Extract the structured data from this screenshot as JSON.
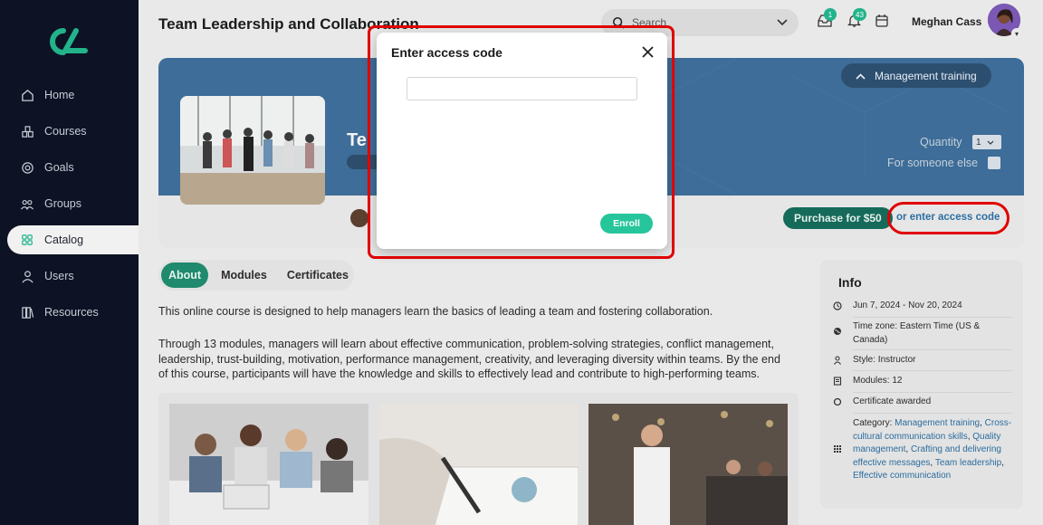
{
  "app": {
    "page_title": "Team Leadership and Collaboration"
  },
  "sidebar": {
    "items": [
      {
        "label": "Home",
        "icon": "home-icon"
      },
      {
        "label": "Courses",
        "icon": "courses-icon"
      },
      {
        "label": "Goals",
        "icon": "goals-icon"
      },
      {
        "label": "Groups",
        "icon": "groups-icon"
      },
      {
        "label": "Catalog",
        "icon": "catalog-icon",
        "active": true
      },
      {
        "label": "Users",
        "icon": "users-icon"
      },
      {
        "label": "Resources",
        "icon": "resources-icon"
      }
    ]
  },
  "header": {
    "search_placeholder": "Search",
    "inbox_count": "1",
    "notifications_count": "43",
    "user_name": "Meghan Cass"
  },
  "banner": {
    "title_visible": "Te",
    "category_pill": "Management training",
    "quantity_label": "Quantity",
    "quantity_value": "1",
    "someone_else_label": "For someone else",
    "purchase_label": "Purchase for $50",
    "access_link": "or enter access code"
  },
  "tabs": [
    "About",
    "Modules",
    "Certificates"
  ],
  "about": {
    "para1": "This online course is designed to help managers learn the basics of leading a team and fostering collaboration.",
    "para2": "Through 13 modules, managers will learn about effective communication, problem-solving strategies, conflict management, leadership, trust-building, motivation, performance management, creativity, and leveraging diversity within teams. By the end of this course, participants will have the knowledge and skills to effectively lead and contribute to high-performing teams."
  },
  "info": {
    "title": "Info",
    "dates": "Jun 7, 2024 - Nov 20, 2024",
    "timezone": "Time zone: Eastern Time (US & Canada)",
    "style": "Style: Instructor",
    "modules": "Modules: 12",
    "certificate": "Certificate awarded",
    "category_label": "Category:",
    "categories": [
      "Management training",
      "Cross-cultural communication skills",
      "Quality management",
      "Crafting and delivering effective messages",
      "Team leadership",
      "Effective communication"
    ]
  },
  "modal": {
    "title": "Enter access code",
    "input_value": "",
    "enroll_label": "Enroll"
  },
  "colors": {
    "sidebar_bg": "#0d1224",
    "accent_green": "#27c59b",
    "banner_blue": "#3d6d98",
    "highlight_red": "#e00000",
    "link_blue": "#2a6c9e"
  }
}
